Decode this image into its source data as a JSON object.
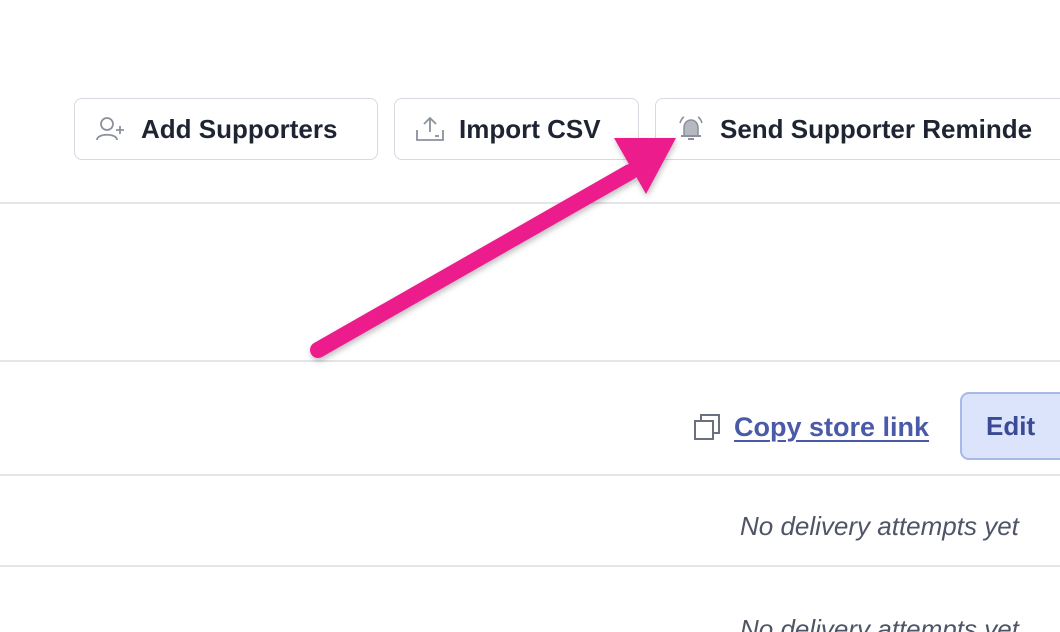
{
  "toolbar": {
    "add_supporters_label": "Add Supporters",
    "import_csv_label": "Import CSV",
    "send_reminder_label": "Send Supporter Reminde"
  },
  "store": {
    "copy_link_label": "Copy store link",
    "edit_label": "Edit"
  },
  "deliveries": {
    "row1_status": "No delivery attempts yet",
    "row2_status": "No delivery attempts yet"
  },
  "annotation": {
    "arrow_color": "#ec1c8c"
  },
  "icons": {
    "add_supporters": "user-plus-icon",
    "import_csv": "upload-icon",
    "send_reminder": "bell-icon",
    "copy_link": "copy-icon"
  }
}
